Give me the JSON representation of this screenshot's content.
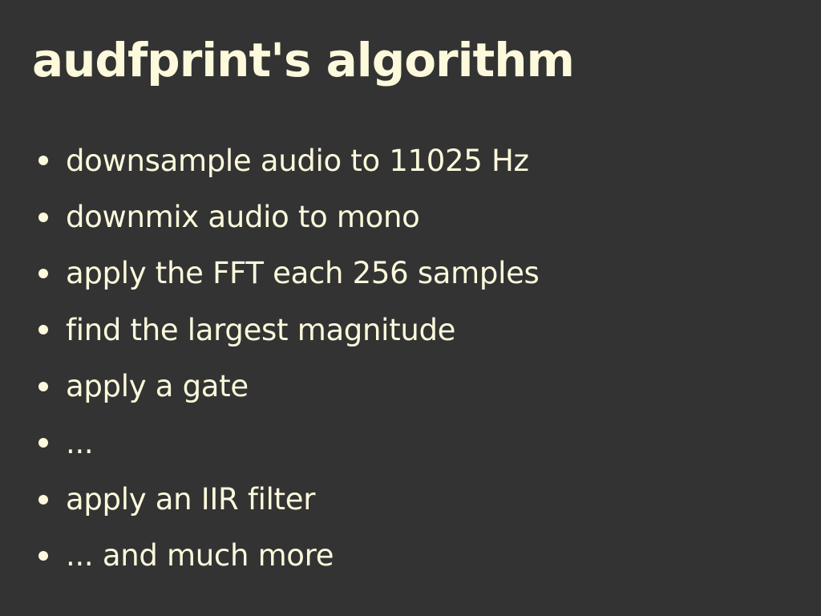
{
  "slide": {
    "title": "audfprint's algorithm",
    "bullets": [
      "downsample audio to 11025 Hz",
      "downmix audio to mono",
      "apply the FFT each 256 samples",
      "find the largest magnitude",
      "apply a gate",
      "...",
      "apply an IIR filter",
      "... and much more"
    ]
  },
  "colors": {
    "background": "#333333",
    "text": "#fcf9dc"
  }
}
